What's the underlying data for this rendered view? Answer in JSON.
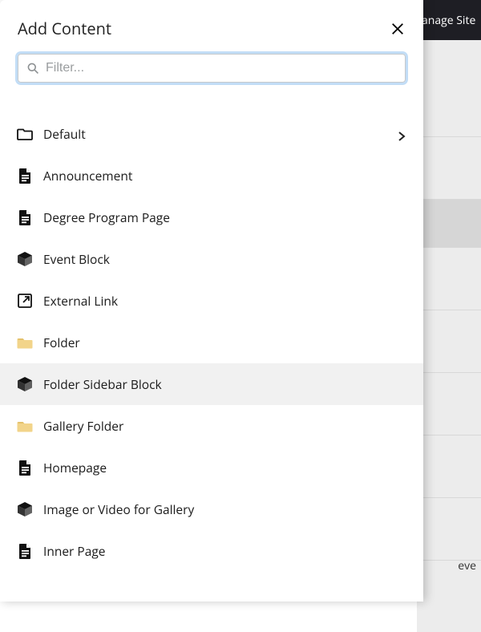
{
  "background": {
    "top_right_text": "anage Site",
    "bottom_right_text": "eve"
  },
  "panel": {
    "title": "Add Content",
    "filter_placeholder": "Filter...",
    "items": [
      {
        "label": "Default",
        "icon": "folder-outline",
        "has_children": true
      },
      {
        "label": "Announcement",
        "icon": "page"
      },
      {
        "label": "Degree Program Page",
        "icon": "page"
      },
      {
        "label": "Event Block",
        "icon": "block"
      },
      {
        "label": "External Link",
        "icon": "external-link"
      },
      {
        "label": "Folder",
        "icon": "folder-filled"
      },
      {
        "label": "Folder Sidebar Block",
        "icon": "block",
        "hovered": true
      },
      {
        "label": "Gallery Folder",
        "icon": "folder-filled"
      },
      {
        "label": "Homepage",
        "icon": "page"
      },
      {
        "label": "Image or Video for Gallery",
        "icon": "block"
      },
      {
        "label": "Inner Page",
        "icon": "page"
      }
    ]
  }
}
